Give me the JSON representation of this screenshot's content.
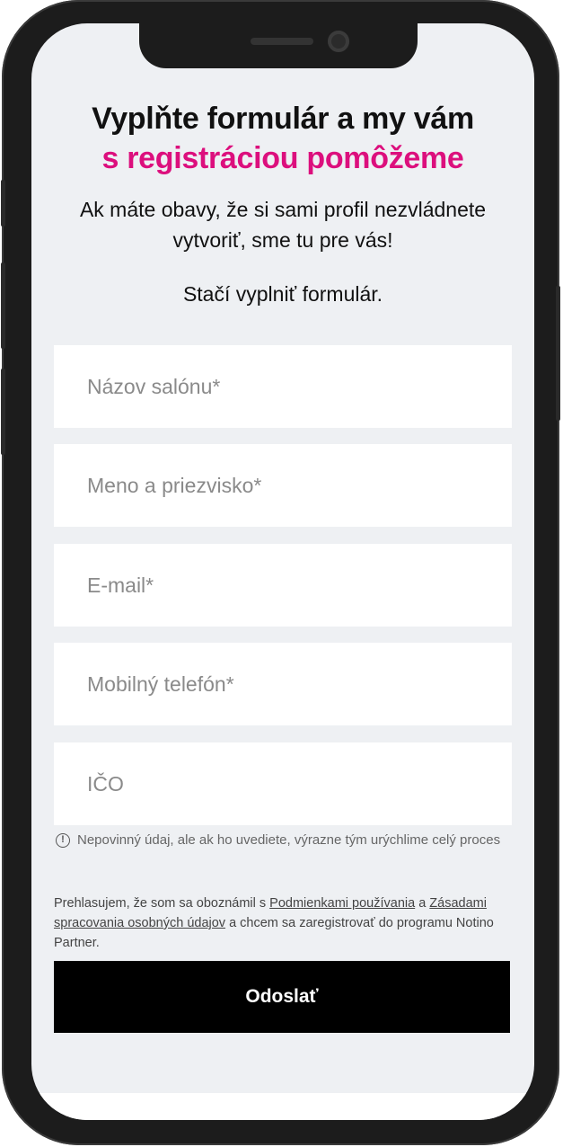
{
  "heading": {
    "line1": "Vyplňte formulár a my vám",
    "line2": "s registráciou pomôžeme"
  },
  "intro": {
    "text": "Ak máte obavy, že si sami profil nezvládnete vytvoriť, sme tu pre vás!",
    "cta": "Stačí vyplniť formulár."
  },
  "form": {
    "salon_name_placeholder": "Názov salónu*",
    "full_name_placeholder": "Meno a priezvisko*",
    "email_placeholder": "E-mail*",
    "phone_placeholder": "Mobilný telefón*",
    "ico_placeholder": "IČO",
    "ico_hint": "Nepovinný údaj, ale ak ho uvediete, výrazne tým urýchlime celý proces",
    "consent": {
      "prefix": "Prehlasujem, že som sa oboznámil s ",
      "terms_link": "Podmienkami používania",
      "middle": " a ",
      "privacy_link": "Zásadami spracovania osobných údajov",
      "suffix": " a chcem sa zaregistrovať do programu Notino Partner."
    },
    "submit_label": "Odoslať"
  },
  "colors": {
    "accent": "#dc0f7d",
    "background": "#eef0f3",
    "button": "#000000"
  },
  "icons": {
    "hint": "info-circle-icon"
  }
}
